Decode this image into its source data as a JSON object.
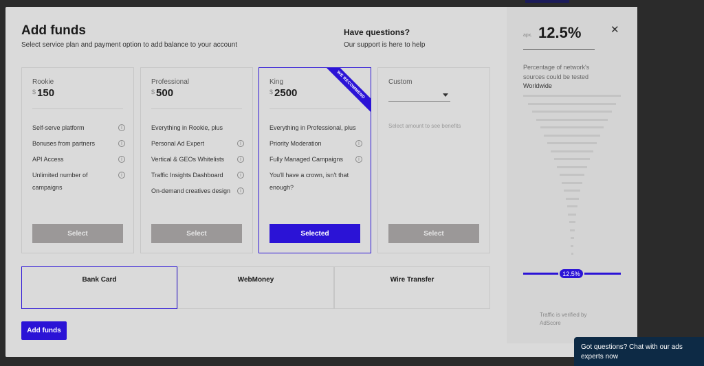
{
  "modal": {
    "title": "Add funds",
    "subtitle": "Select service plan and payment option to add balance to your account",
    "questions_title": "Have questions?",
    "questions_subtitle": "Our support is here to help"
  },
  "plans": [
    {
      "name": "Rookie",
      "currency": "$",
      "amount": "150",
      "features": [
        "Self-serve platform",
        "Bonuses from partners",
        "API Access",
        "Unlimited number of campaigns"
      ],
      "button": "Select",
      "selected": false
    },
    {
      "name": "Professional",
      "currency": "$",
      "amount": "500",
      "features": [
        "Everything in Rookie, plus",
        "Personal Ad Expert",
        "Vertical & GEOs Whitelists",
        "Traffic Insights Dashboard",
        "On-demand creatives design"
      ],
      "button": "Select",
      "selected": false
    },
    {
      "name": "King",
      "currency": "$",
      "amount": "2500",
      "ribbon": "WE RECOMMEND",
      "features": [
        "Everything in Professional, plus",
        "Priority Moderation",
        "Fully Managed Campaigns",
        "You'll have a crown, isn't that enough?"
      ],
      "button": "Selected",
      "selected": true
    },
    {
      "name": "Custom",
      "hint": "Select amount to see benefits",
      "button": "Select",
      "selected": false
    }
  ],
  "payment_methods": [
    {
      "label": "Bank Card",
      "selected": true
    },
    {
      "label": "WebMoney",
      "selected": false
    },
    {
      "label": "Wire Transfer",
      "selected": false
    }
  ],
  "add_funds_button": "Add funds",
  "sidebar": {
    "approx_label": "apx.",
    "percent": "12.5%",
    "description": "Percentage of network's sources could be tested",
    "region": "Worldwide",
    "slider_value": "12.5%",
    "verified": "Traffic is verified by AdScore"
  },
  "close_icon": "close-icon",
  "info_icon": "info-icon",
  "chat": {
    "text": "Got questions? Chat with our ads experts now"
  },
  "colors": {
    "accent": "#2b13d6",
    "modal_bg": "#dadada",
    "chat_bg": "#0d2a45"
  }
}
